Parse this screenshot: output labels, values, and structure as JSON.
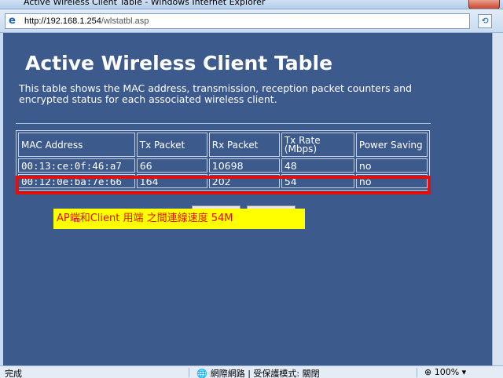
{
  "window": {
    "title": "Active Wireless Client Table - Windows Internet Explorer"
  },
  "address": {
    "host": "http://192.168.1.254",
    "path": "/wlstatbl.asp"
  },
  "page": {
    "title": "Active Wireless Client Table",
    "description": "This table shows the MAC address, transmission, reception packet counters and encrypted status for each associated wireless client."
  },
  "table": {
    "headers": {
      "mac": "MAC Address",
      "tx": "Tx Packet",
      "rx": "Rx Packet",
      "rate_line1": "Tx Rate",
      "rate_line2": "(Mbps)",
      "power": "Power Saving"
    },
    "rows": [
      {
        "mac": "00:13:ce:0f:46:a7",
        "tx": "66",
        "rx": "10698",
        "rate": "48",
        "power": "no"
      },
      {
        "mac": "00:12:0e:ba:7e:66",
        "tx": "164",
        "rx": "202",
        "rate": "54",
        "power": "no"
      }
    ]
  },
  "annotation": {
    "text": "AP端和Client 用端 之間連線速度 54M",
    "color": "#e01010",
    "background": "#ffff00"
  },
  "statusbar": {
    "status": "完成",
    "zone": "網際網路 | 受保護模式: 關閉",
    "zoom": "100%"
  },
  "colors": {
    "page_bg": "#3c5a8c",
    "highlight": "#e01010"
  }
}
